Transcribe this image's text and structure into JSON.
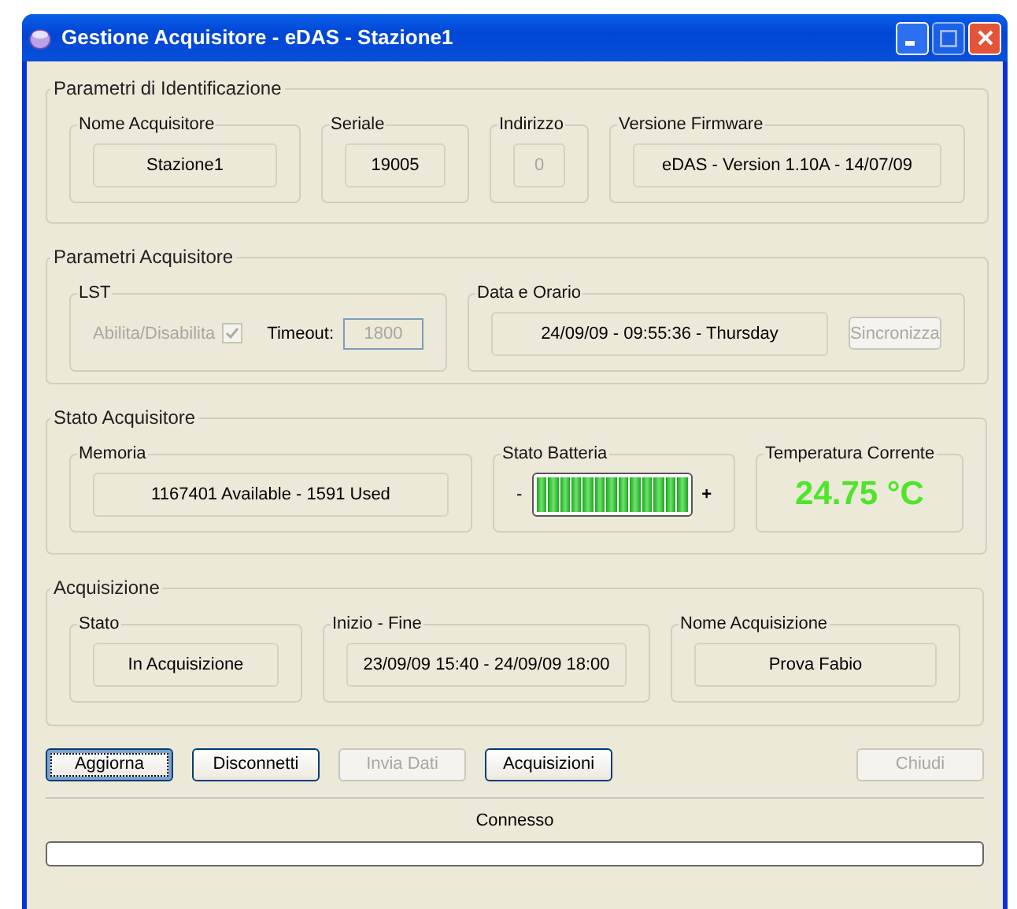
{
  "window": {
    "title": "Gestione Acquisitore - eDAS - Stazione1",
    "controls": [
      {
        "kind": "minimize",
        "disabled": false
      },
      {
        "kind": "maximize",
        "disabled": true
      },
      {
        "kind": "close",
        "disabled": false
      }
    ]
  },
  "sections": [
    {
      "title": "Parametri di Identificazione",
      "groups": [
        {
          "title": "Nome Acquisitore",
          "items": [
            {
              "kind": "field",
              "value": "Stazione1",
              "disabled": false
            }
          ]
        },
        {
          "title": "Seriale",
          "items": [
            {
              "kind": "field",
              "value": "19005",
              "disabled": false
            }
          ]
        },
        {
          "title": "Indirizzo",
          "items": [
            {
              "kind": "field",
              "value": "0",
              "disabled": true
            }
          ]
        },
        {
          "title": "Versione Firmware",
          "items": [
            {
              "kind": "field",
              "value": "eDAS - Version 1.10A - 14/07/09",
              "disabled": false
            }
          ]
        }
      ]
    },
    {
      "title": "Parametri Acquisitore",
      "groups": [
        {
          "title": "LST",
          "items": [
            {
              "kind": "checkbox",
              "label": "Abilita/Disabilita",
              "checked": true,
              "disabled": true
            },
            {
              "kind": "label",
              "text": "Timeout:"
            },
            {
              "kind": "input",
              "value": "1800",
              "disabled": true
            }
          ]
        },
        {
          "title": "Data e Orario",
          "items": [
            {
              "kind": "field",
              "value": "24/09/09 - 09:55:36 - Thursday",
              "disabled": false
            },
            {
              "kind": "button",
              "label": "Sincronizza",
              "disabled": true
            }
          ]
        }
      ]
    },
    {
      "title": "Stato Acquisitore",
      "groups": [
        {
          "title": "Memoria",
          "items": [
            {
              "kind": "field",
              "value": "1167401 Available - 1591 Used",
              "disabled": false
            }
          ]
        },
        {
          "title": "Stato Batteria",
          "items": [
            {
              "kind": "battery",
              "minus": "-",
              "plus": "+",
              "level": 1
            }
          ]
        },
        {
          "title": "Temperatura Corrente",
          "items": [
            {
              "kind": "reading",
              "value": "24.75 °C"
            }
          ]
        }
      ]
    },
    {
      "title": "Acquisizione",
      "groups": [
        {
          "title": "Stato",
          "items": [
            {
              "kind": "field",
              "value": "In Acquisizione",
              "disabled": false
            }
          ]
        },
        {
          "title": "Inizio - Fine",
          "items": [
            {
              "kind": "field",
              "value": "23/09/09 15:40 - 24/09/09 18:00",
              "disabled": false
            }
          ]
        },
        {
          "title": "Nome Acquisizione",
          "items": [
            {
              "kind": "field",
              "value": "Prova Fabio",
              "disabled": false
            }
          ]
        }
      ]
    }
  ],
  "buttons": [
    {
      "label": "Aggiorna",
      "disabled": false,
      "focused": true
    },
    {
      "label": "Disconnetti",
      "disabled": false,
      "focused": false
    },
    {
      "label": "Invia Dati",
      "disabled": true,
      "focused": false
    },
    {
      "label": "Acquisizioni",
      "disabled": false,
      "focused": false
    },
    {
      "label": "Chiudi",
      "disabled": true,
      "focused": false
    }
  ],
  "status": {
    "text": "Connesso",
    "level": 0
  }
}
